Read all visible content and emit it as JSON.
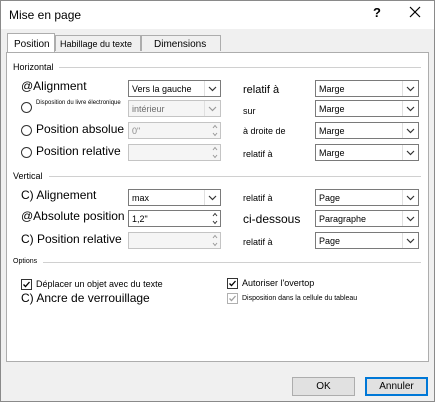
{
  "window": {
    "title": "Mise en page",
    "help_label": "?"
  },
  "tabs": [
    {
      "label": "Position",
      "active": true
    },
    {
      "label": "Habillage du texte",
      "active": false
    },
    {
      "label": "Dimensions",
      "active": false
    }
  ],
  "horizontal": {
    "section_label": "Horizontal",
    "rows": [
      {
        "label": "@Alignment",
        "value": "Vers la gauche",
        "relation": "relatif à",
        "target": "Marge",
        "enabled": true
      },
      {
        "label": "Disposition du livre électronique",
        "value": "intérieur",
        "relation": "sur",
        "target": "Marge",
        "enabled": false
      },
      {
        "label": "Position absolue",
        "value": "0\"",
        "relation": "à droite de",
        "target": "Marge",
        "enabled": false
      },
      {
        "label": "Position relative",
        "value": "",
        "relation": "relatif à",
        "target": "Marge",
        "enabled": false
      }
    ]
  },
  "vertical": {
    "section_label": "Vertical",
    "rows": [
      {
        "label": "C) Alignement",
        "value": "max",
        "relation": "relatif à",
        "target": "Page",
        "enabled": false
      },
      {
        "label": "@Absolute position",
        "value": "1,2\"",
        "relation": "ci-dessous",
        "target": "Paragraphe",
        "enabled": true
      },
      {
        "label": "C) Position relative",
        "value": "",
        "relation": "relatif à",
        "target": "Page",
        "enabled": false
      }
    ]
  },
  "options": {
    "section_label": "Options",
    "move_with_text": {
      "label": "Déplacer un objet avec du texte",
      "checked": true
    },
    "lock_anchor": {
      "label": "C) Ancre de verrouillage"
    },
    "allow_overlap": {
      "label": "Autoriser l'overtop",
      "checked": true
    },
    "layout_in_cell": {
      "label": "Disposition dans  la cellule du tableau",
      "checked": true,
      "enabled": false
    }
  },
  "buttons": {
    "ok": "OK",
    "cancel": "Annuler"
  }
}
